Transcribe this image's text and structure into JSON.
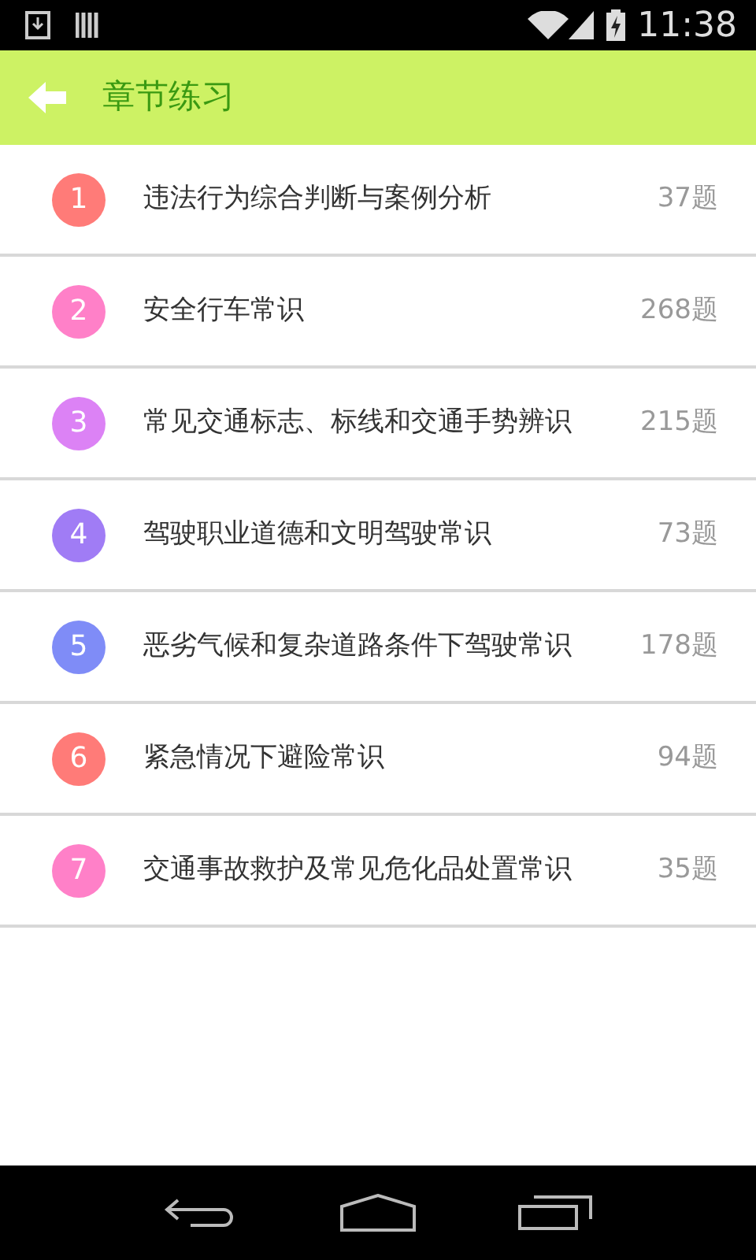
{
  "status_bar": {
    "time": "11:38"
  },
  "header": {
    "title": "章节练习"
  },
  "chapters": [
    {
      "number": "1",
      "title": "违法行为综合判断与案例分析",
      "count": "37题",
      "color": "#ff7b78"
    },
    {
      "number": "2",
      "title": "安全行车常识",
      "count": "268题",
      "color": "#ff80c8"
    },
    {
      "number": "3",
      "title": "常见交通标志、标线和交通手势辨识",
      "count": "215题",
      "color": "#dc82f5"
    },
    {
      "number": "4",
      "title": "驾驶职业道德和文明驾驶常识",
      "count": "73题",
      "color": "#a07cf5"
    },
    {
      "number": "5",
      "title": "恶劣气候和复杂道路条件下驾驶常识",
      "count": "178题",
      "color": "#7f8cf7"
    },
    {
      "number": "6",
      "title": "紧急情况下避险常识",
      "count": "94题",
      "color": "#ff7b78"
    },
    {
      "number": "7",
      "title": "交通事故救护及常见危化品处置常识",
      "count": "35题",
      "color": "#ff80c8"
    }
  ]
}
